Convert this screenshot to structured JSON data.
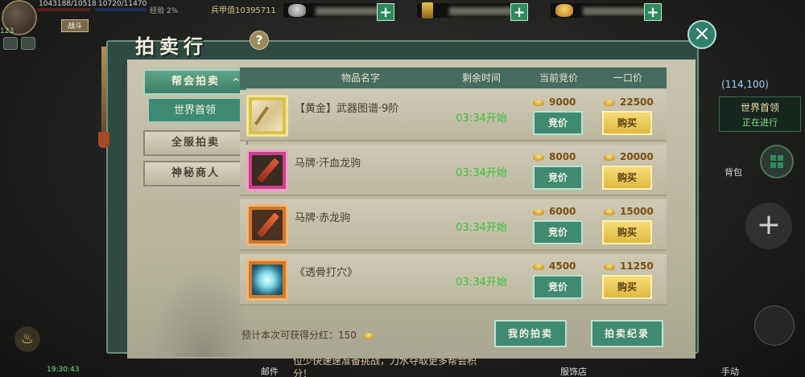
{
  "hud": {
    "hp_text": "1043188/10518",
    "mp_text": "10720/11470",
    "exp_text": "经验 2%",
    "level": "123",
    "war_label": "战斗",
    "power_label": "兵甲值",
    "power_value": "10395711"
  },
  "window": {
    "title": "拍卖行",
    "help_label": "?",
    "close_label": "×"
  },
  "sidebar": {
    "guild_auction": "帮会拍卖",
    "guild_chevron": "^",
    "world_boss": "世界首领",
    "server_auction": "全服拍卖",
    "mystery_merchant": "神秘商人"
  },
  "table": {
    "headers": {
      "name": "物品名字",
      "time": "剩余时间",
      "current_bid": "当前竞价",
      "buyout": "一口价"
    },
    "bid_label": "竞价",
    "buy_label": "购买",
    "rows": [
      {
        "name": "【黄金】武器图谱·9阶",
        "time": "03:34开始",
        "bid": "9000",
        "buyout": "22500",
        "rarity": "yellow",
        "icon": "scroll-icon"
      },
      {
        "name": "马牌·汗血龙驹",
        "time": "03:34开始",
        "bid": "8000",
        "buyout": "20000",
        "rarity": "pink",
        "icon": "horse-plaque-icon"
      },
      {
        "name": "马牌·赤龙驹",
        "time": "03:34开始",
        "bid": "6000",
        "buyout": "15000",
        "rarity": "orange",
        "icon": "horse-plaque-icon"
      },
      {
        "name": "《透骨打穴》",
        "time": "03:34开始",
        "bid": "4500",
        "buyout": "11250",
        "rarity": "orange",
        "icon": "skill-book-icon"
      }
    ]
  },
  "footer": {
    "dividend_text": "预计本次可获得分红：150",
    "my_auction": "我的拍卖",
    "auction_record": "拍卖纪录"
  },
  "side_hud": {
    "coord": "(114,100)",
    "boss_title": "世界首领",
    "boss_status": "正在进行",
    "bag_label": "背包",
    "plus_label": "+",
    "time_text": "19:30:43",
    "chat_text": "位少快速速准备挑战，刀水夺取更多帮会积",
    "chat_text_2": "分！",
    "mail_label": "邮件",
    "shop_label": "服饰店",
    "auto_label": "手动"
  }
}
